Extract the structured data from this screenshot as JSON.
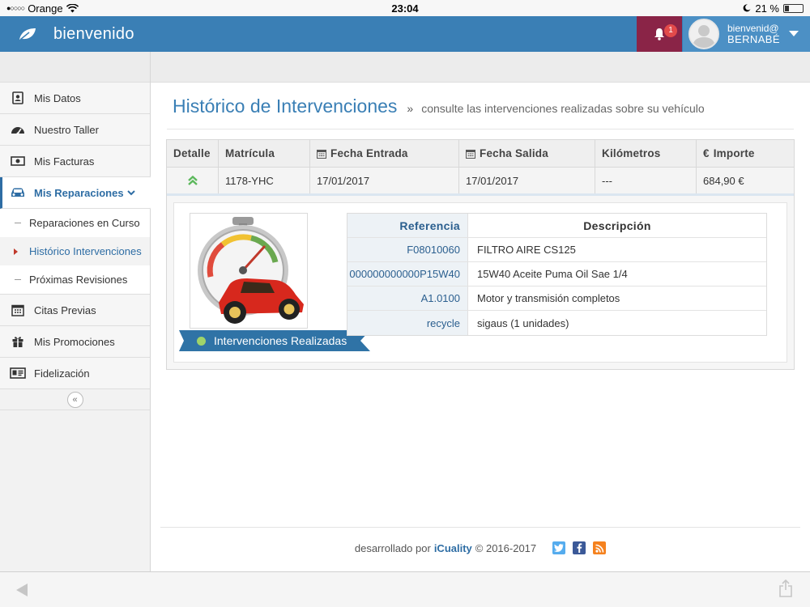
{
  "status": {
    "carrier": "Orange",
    "time": "23:04",
    "battery": "21 %"
  },
  "header": {
    "title": "bienvenido",
    "notifications": "1",
    "greeting": "bienvenid@",
    "username": "BERNABÉ"
  },
  "sidebar": {
    "items": [
      {
        "label": "Mis Datos",
        "icon": "contact-card-icon"
      },
      {
        "label": "Nuestro Taller",
        "icon": "speedometer-icon"
      },
      {
        "label": "Mis Facturas",
        "icon": "banknote-icon"
      },
      {
        "label": "Mis Reparaciones",
        "icon": "car-icon"
      },
      {
        "label": "Citas Previas",
        "icon": "calendar-icon"
      },
      {
        "label": "Mis Promociones",
        "icon": "gift-icon"
      },
      {
        "label": "Fidelización",
        "icon": "id-card-icon"
      }
    ],
    "subitems": [
      "Reparaciones en Curso",
      "Histórico Intervenciones",
      "Próximas Revisiones"
    ],
    "collapse": "«"
  },
  "page": {
    "title": "Histórico de Intervenciones",
    "separator": "»",
    "subtitle": "consulte las intervenciones realizadas sobre su vehículo"
  },
  "table": {
    "headers": [
      "Detalle",
      "Matrícula",
      "Fecha Entrada",
      "Fecha Salida",
      "Kilómetros",
      "Importe"
    ],
    "row": {
      "matricula": "1178-YHC",
      "entrada": "17/01/2017",
      "salida": "17/01/2017",
      "km": "---",
      "importe": "684,90 €"
    }
  },
  "detail": {
    "ribbon": "Intervenciones Realizadas",
    "headers": [
      "Referencia",
      "Descripción"
    ],
    "parts": [
      {
        "ref": "F08010060",
        "desc": "FILTRO AIRE CS125"
      },
      {
        "ref": "000000000000P15W40",
        "desc": "15W40 Aceite Puma Oil Sae 1/4"
      },
      {
        "ref": "A1.0100",
        "desc": "Motor y transmisión completos"
      },
      {
        "ref": "recycle",
        "desc": "sigaus (1 unidades)"
      }
    ]
  },
  "footer": {
    "prefix": "desarrollado por",
    "brand": "iCuality",
    "copyright": "© 2016-2017"
  },
  "colors": {
    "header": "#3a7fb5",
    "bell_bg": "#8a2447",
    "accent": "#2e6da4"
  }
}
